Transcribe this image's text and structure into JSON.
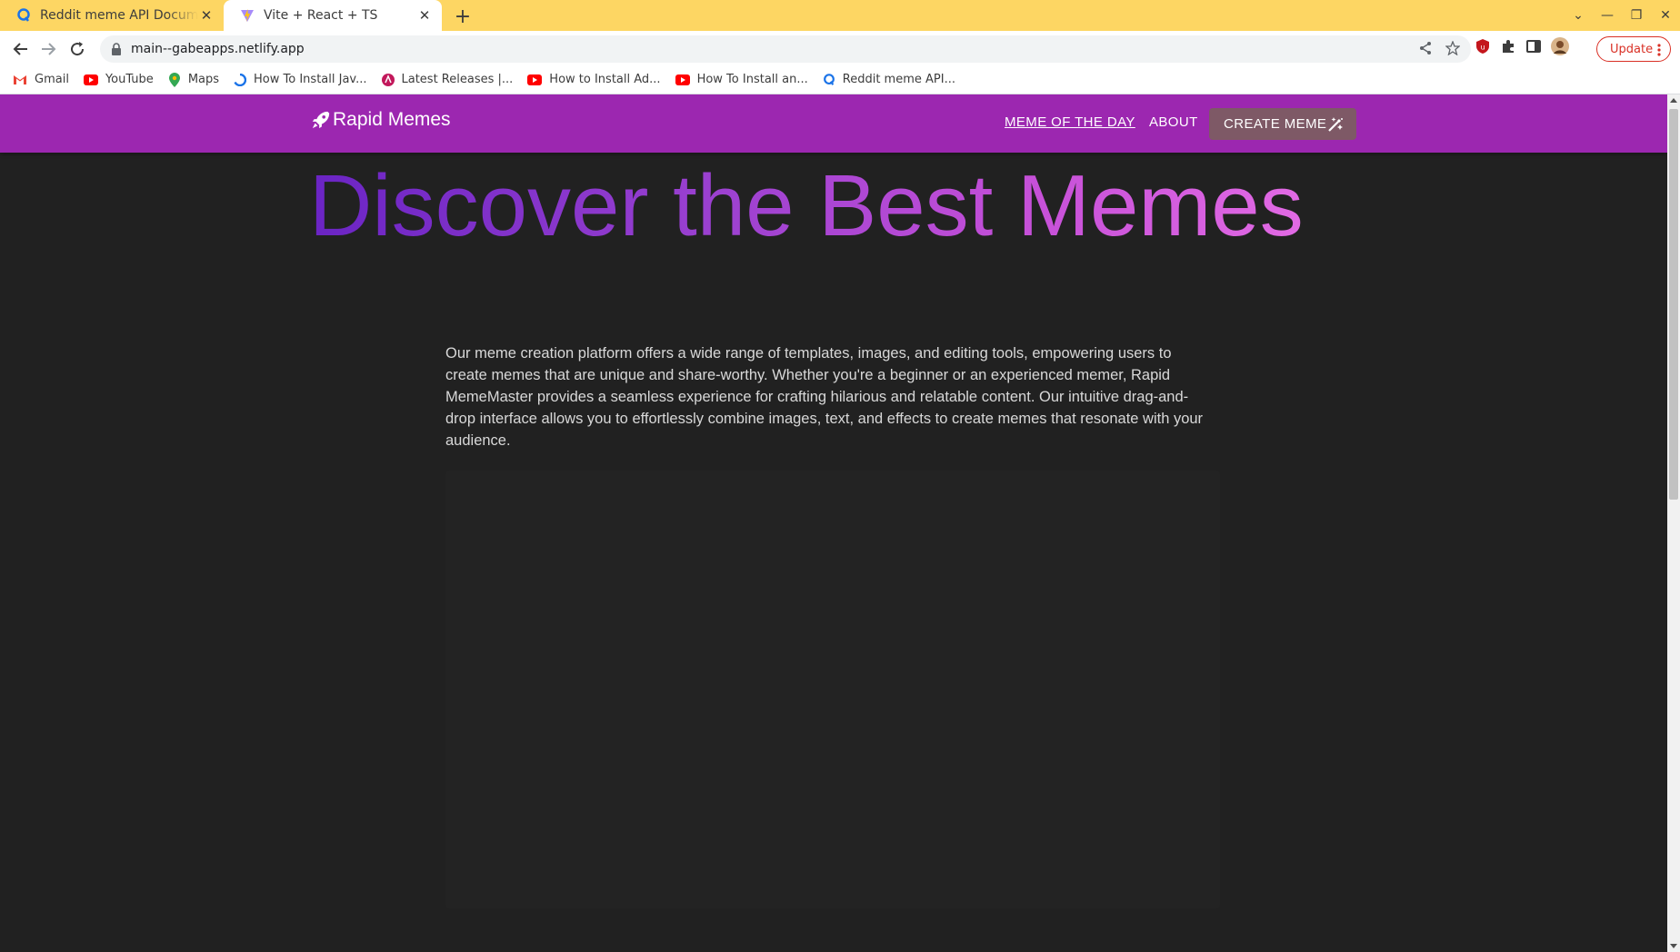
{
  "browser": {
    "tabs": [
      {
        "title": "Reddit meme API Documentation",
        "icon": "reddit-api-favicon",
        "active": false
      },
      {
        "title": "Vite + React + TS",
        "icon": "vite-favicon",
        "active": true
      }
    ],
    "url": "main--gabeapps.netlify.app",
    "update_label": "Update",
    "bookmarks": [
      {
        "label": "Gmail",
        "icon": "gmail-icon"
      },
      {
        "label": "YouTube",
        "icon": "youtube-icon"
      },
      {
        "label": "Maps",
        "icon": "maps-icon"
      },
      {
        "label": "How To Install Jav...",
        "icon": "blue-circle-icon"
      },
      {
        "label": "Latest Releases |...",
        "icon": "pink-logo-icon"
      },
      {
        "label": "How to Install Ad...",
        "icon": "youtube-icon"
      },
      {
        "label": "How To Install an...",
        "icon": "youtube-icon"
      },
      {
        "label": "Reddit meme API...",
        "icon": "reddit-api-favicon"
      }
    ]
  },
  "app": {
    "brand": "Rapid Memes",
    "nav": {
      "meme_of_the_day": "MEME OF THE DAY",
      "about": "ABOUT",
      "create_meme": "CREATE MEME"
    },
    "hero_title": "Discover the Best Memes",
    "intro": "Our meme creation platform offers a wide range of templates, images, and editing tools, empowering users to create memes that are unique and share-worthy. Whether you're a beginner or an experienced memer, Rapid MemeMaster provides a seamless experience for crafting hilarious and relatable content. Our intuitive drag-and-drop interface allows you to effortlessly combine images, text, and effects to create memes that resonate with your audience.",
    "colors": {
      "appbar": "#9c27b0",
      "create_button": "#7e5966",
      "background": "#212121",
      "tabstrip": "#fdd663"
    }
  }
}
